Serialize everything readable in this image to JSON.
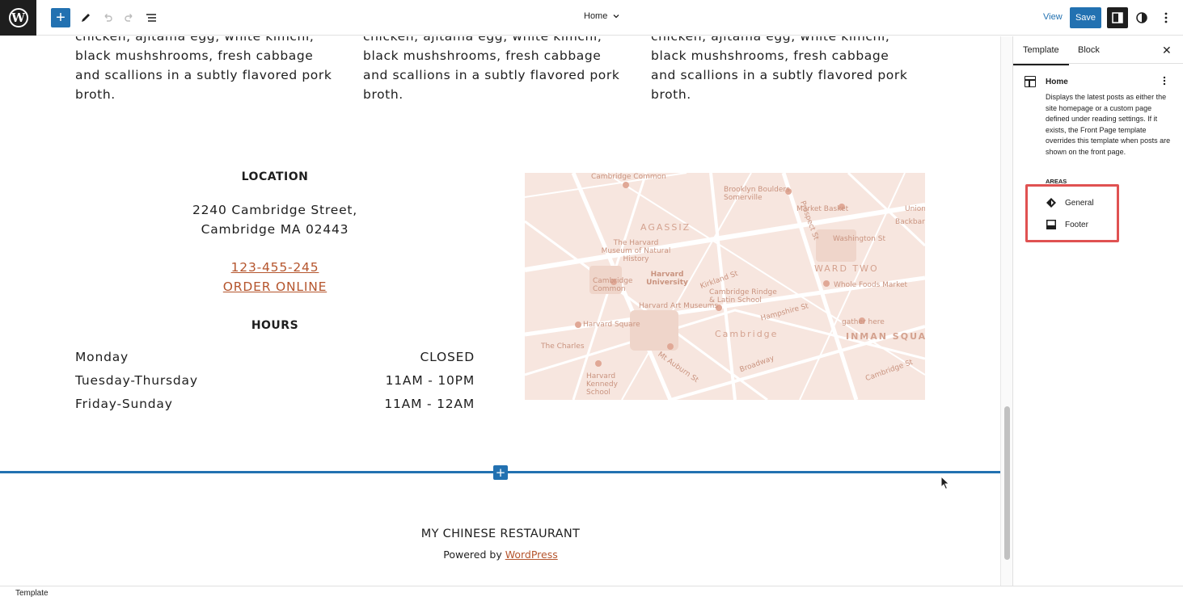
{
  "topbar": {
    "logo": "W",
    "add_icon": "+",
    "document_title": "Home",
    "view_label": "View",
    "save_label": "Save",
    "icons": [
      "wordpress-logo",
      "plus-icon",
      "pencil-icon",
      "undo-icon",
      "redo-icon",
      "list-view-icon",
      "chevron-down-icon",
      "sidebar-icon",
      "styles-icon",
      "more-vertical-icon"
    ]
  },
  "menu": {
    "items": [
      {
        "description": "chicken, ajitama egg, white kimchi, black mushshrooms, fresh cabbage and scallions in a subtly flavored pork broth."
      },
      {
        "description": "chicken, ajitama egg, white kimchi, black mushshrooms, fresh cabbage and scallions in a subtly flavored pork broth."
      },
      {
        "description": "chicken, ajitama egg, white kimchi, black mushshrooms, fresh cabbage and scallions in a subtly flavored pork broth."
      }
    ]
  },
  "location": {
    "title": "LOCATION",
    "address_line1": "2240 Cambridge Street,",
    "address_line2": "Cambridge MA 02443",
    "phone": "123-455-245",
    "order_online": "ORDER ONLINE"
  },
  "hours": {
    "title": "HOURS",
    "rows": [
      {
        "day": "Monday",
        "time": "CLOSED"
      },
      {
        "day": "Tuesday-Thursday",
        "time": "11AM - 10PM"
      },
      {
        "day": "Friday-Sunday",
        "time": "11AM - 12AM"
      }
    ]
  },
  "map": {
    "labels": [
      "Cambridge Common",
      "Brooklyn Boulders Somerville",
      "Market Basket",
      "Union Sq",
      "Backbar",
      "AGASSIZ",
      "The Harvard Museum of Natural History",
      "Washington St",
      "WARD TWO",
      "Harvard University",
      "Cambridge Common",
      "Whole Foods Market",
      "Cambridge Rindge & Latin School",
      "Harvard Art Museums",
      "Harvard Square",
      "Cambridge",
      "gather here",
      "INMAN SQUARE",
      "The Charles",
      "Harvard Kennedy School",
      "Mt Auburn St",
      "Kirkland St",
      "Broadway",
      "Hampshire St",
      "Prospect St",
      "Cambridge St"
    ]
  },
  "insert": {
    "icon": "+"
  },
  "footer": {
    "site_title": "MY CHINESE RESTAURANT",
    "powered_by": "Powered by ",
    "powered_link": "WordPress"
  },
  "sidebar": {
    "tab_template": "Template",
    "tab_block": "Block",
    "close_icon": "✕",
    "template_name": "Home",
    "template_description": "Displays the latest posts as either the site homepage or a custom page defined under reading settings. If it exists, the Front Page template overrides this template when posts are shown on the front page.",
    "areas_label": "AREAS",
    "areas": [
      {
        "label": "General"
      },
      {
        "label": "Footer"
      }
    ],
    "highlight_color": "#e05252"
  },
  "statusbar": {
    "breadcrumb": "Template"
  },
  "colors": {
    "accent": "#2271b1",
    "link": "#b5552d",
    "map_bg": "#f7e6df"
  }
}
